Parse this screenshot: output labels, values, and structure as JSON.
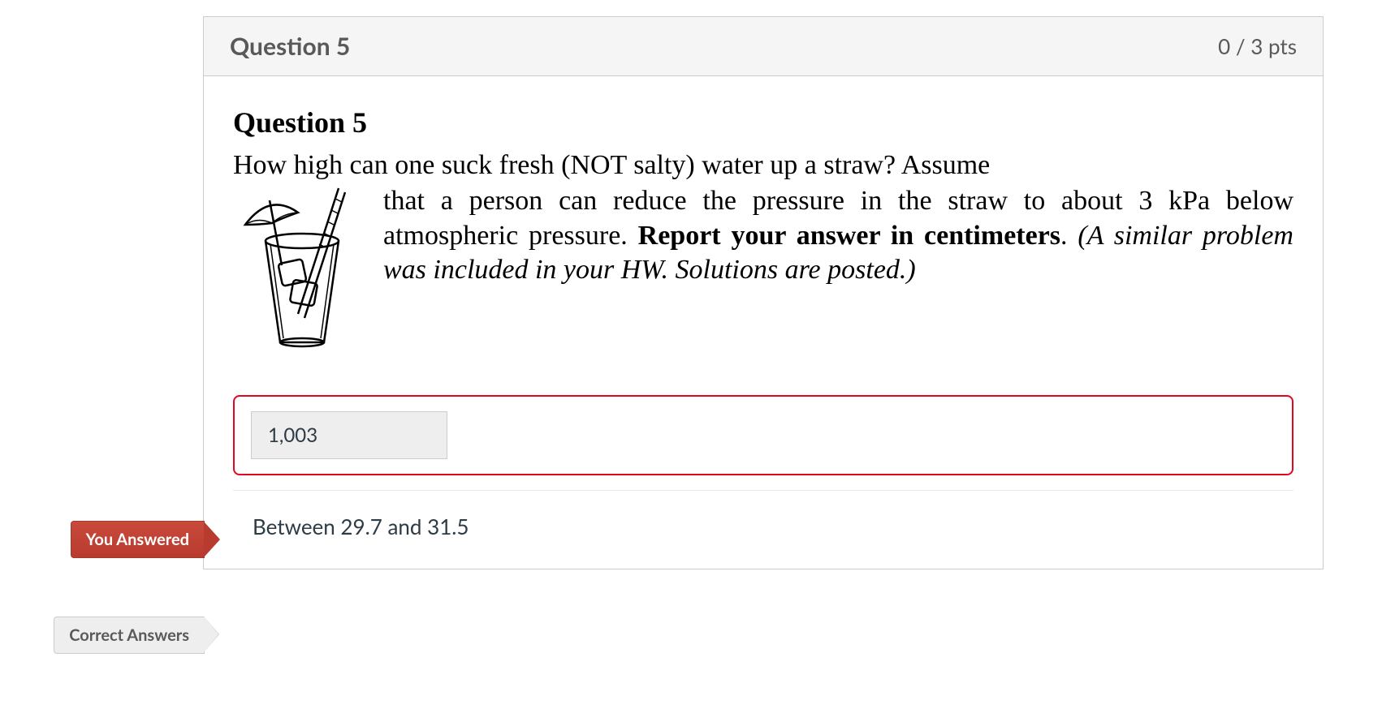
{
  "header": {
    "title": "Question 5",
    "points": "0 / 3 pts"
  },
  "question": {
    "inner_title": "Question 5",
    "line1": "How high can one suck fresh (NOT salty) water up a straw? Assume",
    "line2a": "that a person can reduce the pressure in the straw to about 3 kPa below atmospheric pressure. ",
    "line2b_bold": "Report your answer in centimeters",
    "line2c": ". ",
    "line2d_italic": "(A similar problem was included in your HW. Solutions are posted.)",
    "illustration_name": "drink-glass-with-straw-icon"
  },
  "labels": {
    "you_answered": "You Answered",
    "correct_answers": "Correct Answers"
  },
  "answer": {
    "user_value": "1,003",
    "correct_text": "Between 29.7 and 31.5"
  }
}
